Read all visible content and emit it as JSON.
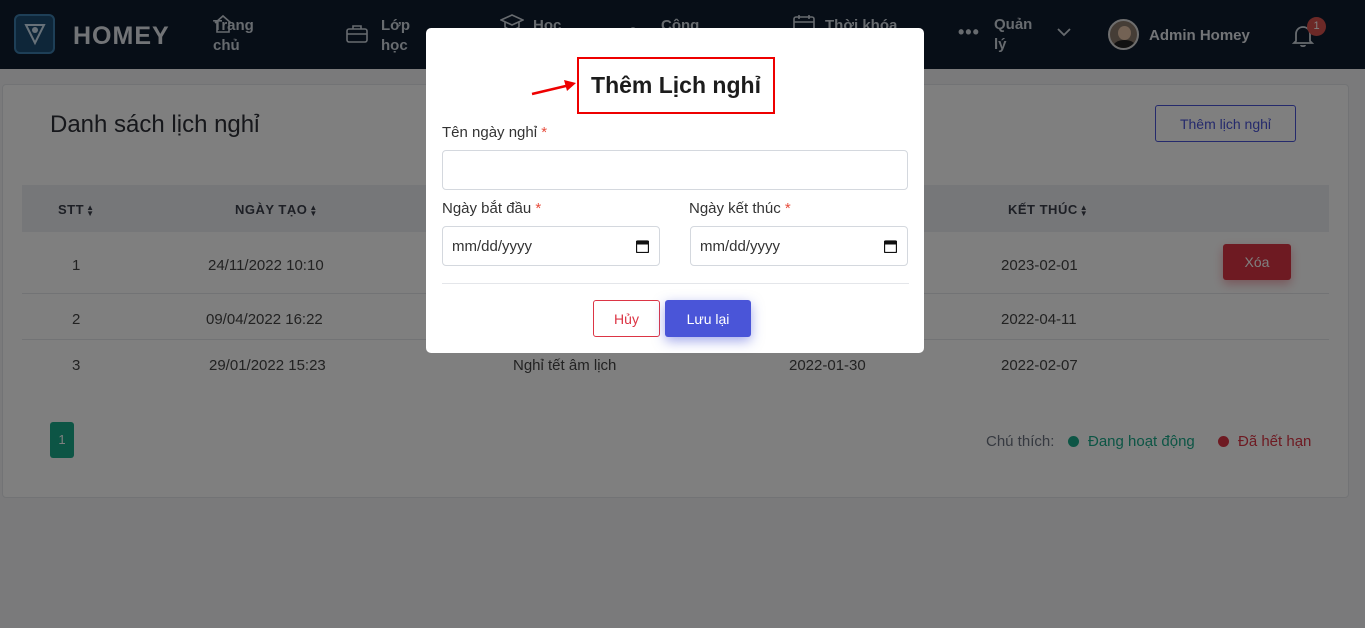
{
  "app": {
    "brand": "HOMEY"
  },
  "nav": {
    "items": [
      {
        "label": "Trang\nchủ",
        "icon": "home-icon"
      },
      {
        "label": "Lớp\nhọc",
        "icon": "briefcase-icon"
      },
      {
        "label": "Học",
        "icon": "graduation-cap-icon"
      },
      {
        "label": "Công",
        "icon": "user-icon"
      },
      {
        "label": "Thời khóa",
        "icon": "calendar-icon"
      },
      {
        "label": "Quản\nlý",
        "icon": "more-icon"
      }
    ],
    "user_name": "Admin Homey",
    "notification_count": "1"
  },
  "page": {
    "title": "Danh sách lịch nghỉ",
    "add_button": "Thêm lịch nghỉ",
    "columns": [
      "STT",
      "NGÀY TẠO",
      "KẾT THÚC"
    ],
    "rows": [
      {
        "stt": "1",
        "created": "24/11/2022 10:10",
        "name": "",
        "start": "",
        "end": "2023-02-01",
        "action": "Xóa"
      },
      {
        "stt": "2",
        "created": "09/04/2022 16:22",
        "name": "",
        "start": "",
        "end": "2022-04-11",
        "action": ""
      },
      {
        "stt": "3",
        "created": "29/01/2022 15:23",
        "name": "Nghỉ tết âm lịch",
        "start": "2022-01-30",
        "end": "2022-02-07",
        "action": ""
      }
    ],
    "pagination": {
      "current": "1"
    },
    "legend": {
      "label": "Chú thích:",
      "active": "Đang hoạt động",
      "expired": "Đã hết hạn"
    },
    "colors": {
      "active": "#1aab8a",
      "expired": "#dc3545",
      "primary": "#4a55d8"
    }
  },
  "modal": {
    "title": "Thêm Lịch nghỉ",
    "name_label": "Tên ngày nghỉ",
    "name_value": "",
    "start_label": "Ngày bắt đầu",
    "start_placeholder": "mm/dd/yyyy",
    "end_label": "Ngày kết thúc",
    "end_placeholder": "mm/dd/yyyy",
    "required_mark": "*",
    "cancel_button": "Hủy",
    "save_button": "Lưu lại"
  }
}
